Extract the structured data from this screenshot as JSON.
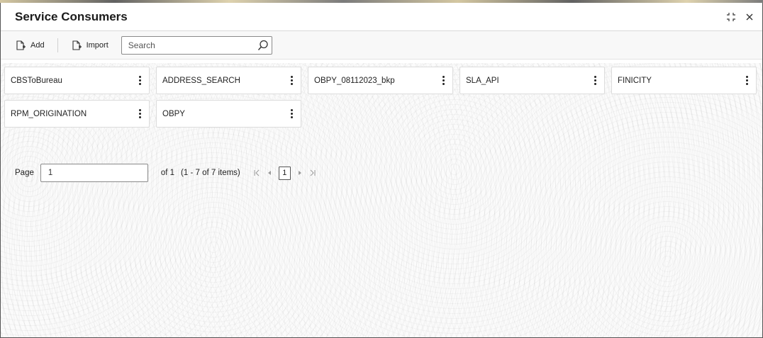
{
  "window": {
    "title": "Service Consumers"
  },
  "controls": {
    "restore_icon": "collapse-icon",
    "close_icon": "close-icon"
  },
  "toolbar": {
    "add_label": "Add",
    "import_label": "Import",
    "search_placeholder": "Search",
    "search_value": ""
  },
  "consumers": [
    {
      "name": "CBSToBureau"
    },
    {
      "name": "ADDRESS_SEARCH"
    },
    {
      "name": "OBPY_08112023_bkp"
    },
    {
      "name": "SLA_API"
    },
    {
      "name": "FINICITY"
    },
    {
      "name": "RPM_ORIGINATION"
    },
    {
      "name": "OBPY"
    }
  ],
  "pagination": {
    "page_label": "Page",
    "page_value": "1",
    "of_text": "of 1",
    "items_text": "(1 - 7 of 7 items)",
    "current_page": "1",
    "first_icon": "first-page-icon",
    "prev_icon": "previous-page-icon",
    "next_icon": "next-page-icon",
    "last_icon": "last-page-icon"
  },
  "colors": {
    "border": "#dcdcdc",
    "input_border": "#8a8a8a",
    "text": "#222222"
  }
}
